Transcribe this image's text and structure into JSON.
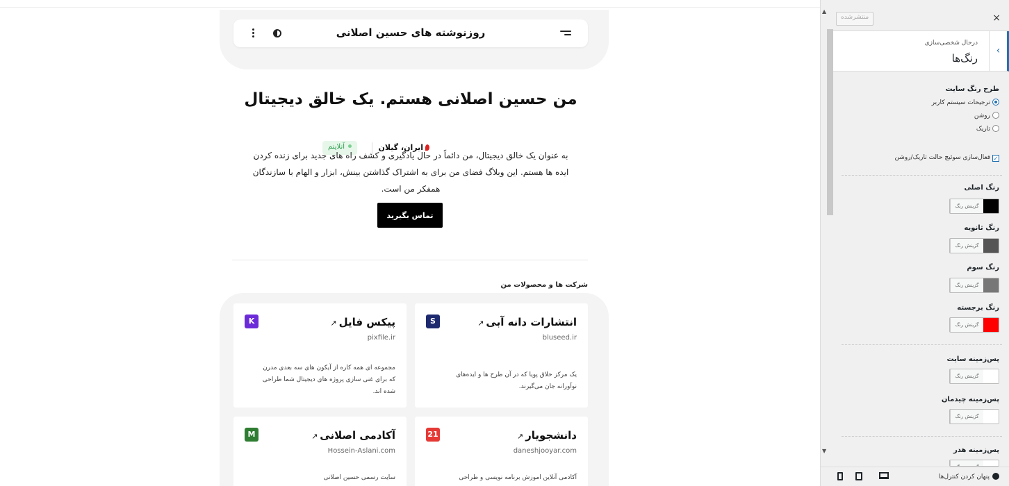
{
  "site": {
    "title": "روزنوشته های حسین اصلانی"
  },
  "hero": {
    "title": "من حسین اصلانی هستم. یک خالق دیجیتال",
    "location": "ایران، گیلان",
    "status": "آنلاینم",
    "description": "به عنوان یک خالق دیجیتال، من دائماً در حال یادگیری و کشف راه های جدید برای زنده کردن ایده ها هستم. این وبلاگ فضای من برای به اشتراک گذاشتن بینش، ابزار و الهام با سازندگان همفکر من است.",
    "cta_label": "تماس بگیرید"
  },
  "products": {
    "section_title": "شرکت ها و محصولات من",
    "cards": [
      {
        "title": "انتشارات دانه آبی",
        "url": "bluseed.ir",
        "description": "یک مرکز خلاق پویا که در آن طرح ها و ایده‌های نوآورانه جان می‌گیرند.",
        "logo_text": "S",
        "logo_color": "#1e2a6e"
      },
      {
        "title": "پیکس فایل",
        "url": "pixfile.ir",
        "description": "مجموعه ای همه کاره از آیکون های سه بعدی مدرن که برای غنی سازی پروژه های دیجیتال شما طراحی شده اند.",
        "logo_text": "K",
        "logo_color": "#6c2bd9"
      },
      {
        "title": "دانشجویار",
        "url": "daneshjooyar.com",
        "description": "آکادمی آنلاین اموزش برنامه نویسی و طراحی",
        "logo_text": "21",
        "logo_color": "#e53935"
      },
      {
        "title": "آکادمی اصلانی",
        "url": "Hossein-Aslani.com",
        "description": "سایت رسمی حسین اصلانی",
        "logo_text": "M",
        "logo_color": "#2e7d32"
      }
    ],
    "arrow": "↗"
  },
  "panel": {
    "close": "×",
    "published": "منتشرشده",
    "breadcrumb": "درحال شخصی‌سازی",
    "section_name": "رنگ‌ها",
    "scheme_title": "طرح رنگ سایت",
    "scheme_options": [
      "ترجیحات سیستم کاربر",
      "روشن",
      "تاریک"
    ],
    "scheme_selected": "ترجیحات سیستم کاربر",
    "toggle_label": "فعال‌سازی سوئیچ حالت تاریک/روشن",
    "picker_label": "گزینش رنگ",
    "colors": [
      {
        "label": "رنگ اصلی",
        "value": "#000000"
      },
      {
        "label": "رنگ ثانویه",
        "value": "#555555"
      },
      {
        "label": "رنگ سوم",
        "value": "#777777"
      },
      {
        "label": "رنگ برجسته",
        "value": "#ff0000"
      },
      {
        "label": "پس‌زمینه سایت",
        "value": "#ffffff"
      },
      {
        "label": "پس‌زمینه چیدمان",
        "value": "#ffffff"
      },
      {
        "label": "پس‌زمینه هدر",
        "value": "#ffffff"
      }
    ],
    "hide_controls": "پنهان کردن کنترل‌ها"
  }
}
